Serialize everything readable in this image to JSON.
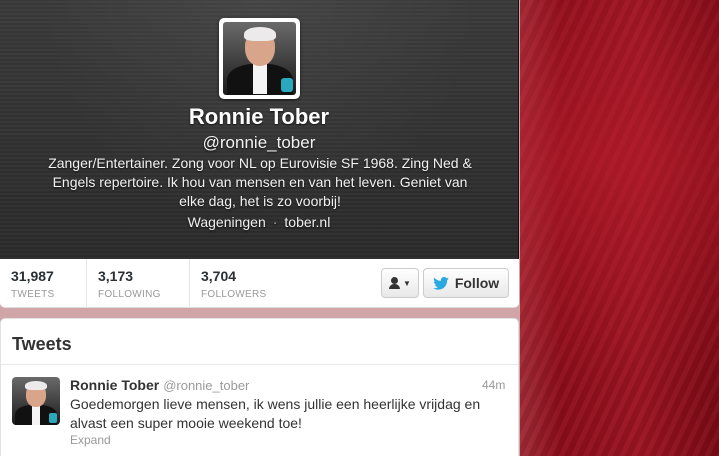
{
  "profile": {
    "name": "Ronnie Tober",
    "handle": "@ronnie_tober",
    "bio": "Zanger/Entertainer. Zong voor NL op Eurovisie SF 1968. Zing Ned & Engels repertoire. Ik hou van mensen en van het leven. Geniet van elke dag, het is zo voorbij!",
    "location": "Wageningen",
    "separator": "·",
    "website": "tober.nl"
  },
  "stats": [
    {
      "value": "31,987",
      "label": "TWEETS"
    },
    {
      "value": "3,173",
      "label": "FOLLOWING"
    },
    {
      "value": "3,704",
      "label": "FOLLOWERS"
    }
  ],
  "actions": {
    "user_menu_icon": "person-dropdown-icon",
    "follow_label": "Follow",
    "follow_icon": "twitter-bird-icon"
  },
  "tweets_section": {
    "title": "Tweets",
    "items": [
      {
        "name": "Ronnie Tober",
        "handle": "@ronnie_tober",
        "time": "44m",
        "text": "Goedemorgen lieve mensen, ik wens jullie een heerlijke vrijdag en alvast een super mooie weekend toe!",
        "expand": "Expand"
      }
    ]
  },
  "colors": {
    "background_red": "#8a0f1c",
    "header_dark": "#2e2e2e",
    "twitter_blue": "#2aa9e0"
  }
}
